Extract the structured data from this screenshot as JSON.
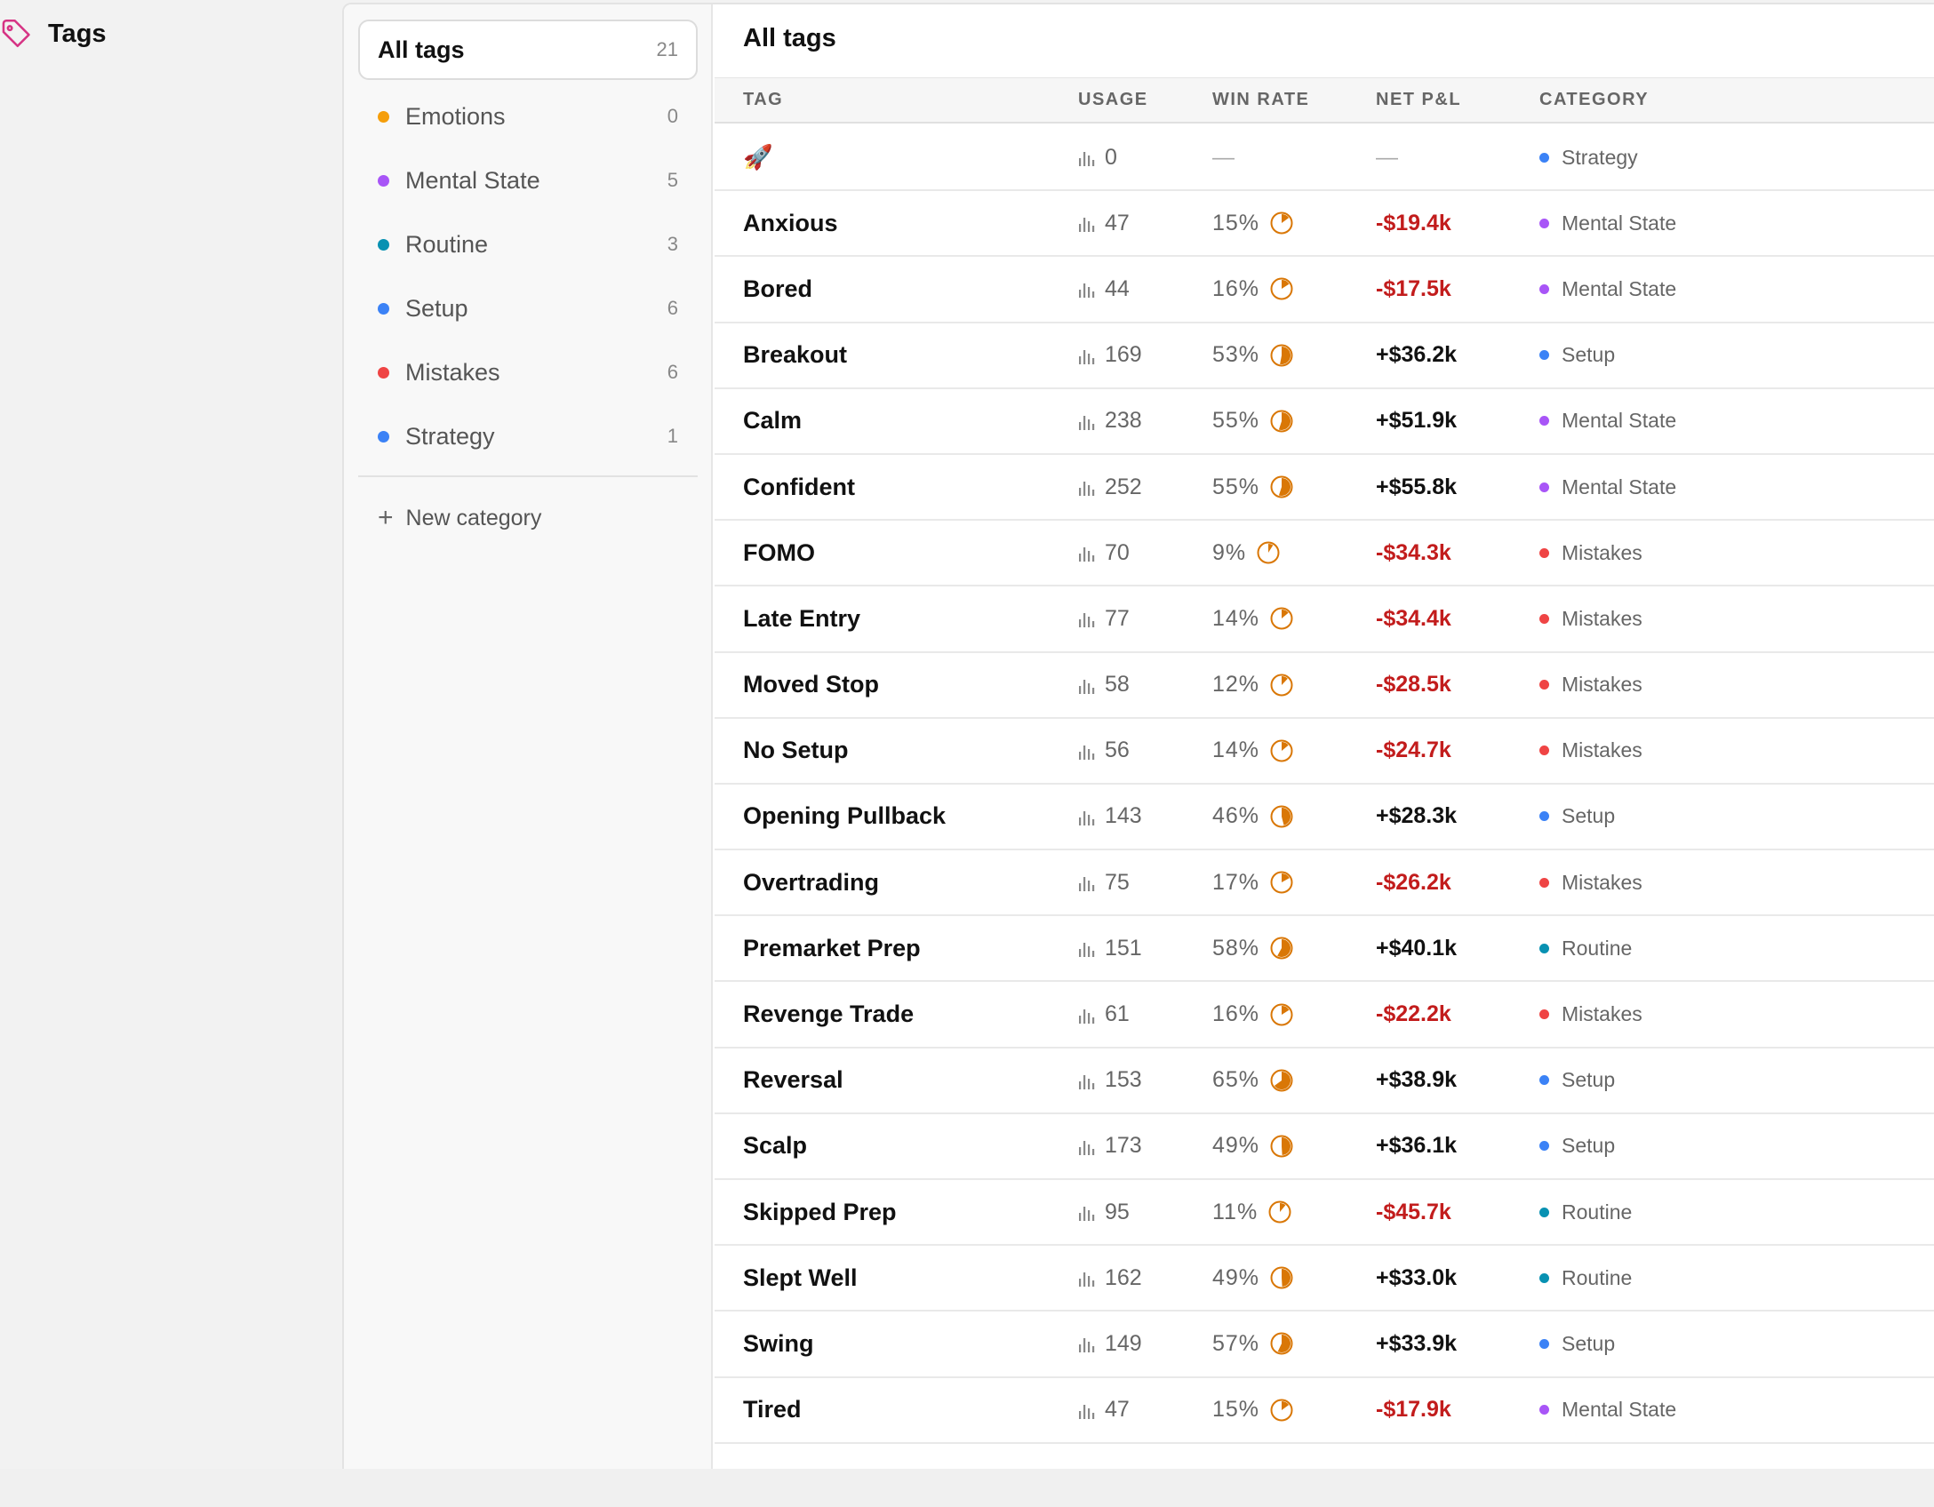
{
  "app": {
    "title": "Tags",
    "icon": "tag-icon"
  },
  "categories_panel": {
    "all": {
      "label": "All tags",
      "count": "21"
    },
    "items": [
      {
        "label": "Emotions",
        "count": "0",
        "color": "#f59e0b"
      },
      {
        "label": "Mental State",
        "count": "5",
        "color": "#a855f7"
      },
      {
        "label": "Routine",
        "count": "3",
        "color": "#0891b2"
      },
      {
        "label": "Setup",
        "count": "6",
        "color": "#3b82f6"
      },
      {
        "label": "Mistakes",
        "count": "6",
        "color": "#ef4444"
      },
      {
        "label": "Strategy",
        "count": "1",
        "color": "#3b82f6"
      }
    ],
    "new_category_label": "New category"
  },
  "table": {
    "title": "All tags",
    "columns": {
      "tag": "TAG",
      "usage": "USAGE",
      "win_rate": "WIN RATE",
      "net_pnl": "NET P&L",
      "category": "CATEGORY"
    },
    "rows": [
      {
        "tag": "🚀",
        "usage": "0",
        "win_rate": "—",
        "win": null,
        "net_pnl": "—",
        "pnl_sign": "nil",
        "category": "Strategy",
        "cat_color": "#3b82f6"
      },
      {
        "tag": "Anxious",
        "usage": "47",
        "win_rate": "15%",
        "win": 0.15,
        "net_pnl": "-$19.4k",
        "pnl_sign": "neg",
        "category": "Mental State",
        "cat_color": "#a855f7"
      },
      {
        "tag": "Bored",
        "usage": "44",
        "win_rate": "16%",
        "win": 0.16,
        "net_pnl": "-$17.5k",
        "pnl_sign": "neg",
        "category": "Mental State",
        "cat_color": "#a855f7"
      },
      {
        "tag": "Breakout",
        "usage": "169",
        "win_rate": "53%",
        "win": 0.53,
        "net_pnl": "+$36.2k",
        "pnl_sign": "pos",
        "category": "Setup",
        "cat_color": "#3b82f6"
      },
      {
        "tag": "Calm",
        "usage": "238",
        "win_rate": "55%",
        "win": 0.55,
        "net_pnl": "+$51.9k",
        "pnl_sign": "pos",
        "category": "Mental State",
        "cat_color": "#a855f7"
      },
      {
        "tag": "Confident",
        "usage": "252",
        "win_rate": "55%",
        "win": 0.55,
        "net_pnl": "+$55.8k",
        "pnl_sign": "pos",
        "category": "Mental State",
        "cat_color": "#a855f7"
      },
      {
        "tag": "FOMO",
        "usage": "70",
        "win_rate": "9%",
        "win": 0.09,
        "net_pnl": "-$34.3k",
        "pnl_sign": "neg",
        "category": "Mistakes",
        "cat_color": "#ef4444"
      },
      {
        "tag": "Late Entry",
        "usage": "77",
        "win_rate": "14%",
        "win": 0.14,
        "net_pnl": "-$34.4k",
        "pnl_sign": "neg",
        "category": "Mistakes",
        "cat_color": "#ef4444"
      },
      {
        "tag": "Moved Stop",
        "usage": "58",
        "win_rate": "12%",
        "win": 0.12,
        "net_pnl": "-$28.5k",
        "pnl_sign": "neg",
        "category": "Mistakes",
        "cat_color": "#ef4444"
      },
      {
        "tag": "No Setup",
        "usage": "56",
        "win_rate": "14%",
        "win": 0.14,
        "net_pnl": "-$24.7k",
        "pnl_sign": "neg",
        "category": "Mistakes",
        "cat_color": "#ef4444"
      },
      {
        "tag": "Opening Pullback",
        "usage": "143",
        "win_rate": "46%",
        "win": 0.46,
        "net_pnl": "+$28.3k",
        "pnl_sign": "pos",
        "category": "Setup",
        "cat_color": "#3b82f6"
      },
      {
        "tag": "Overtrading",
        "usage": "75",
        "win_rate": "17%",
        "win": 0.17,
        "net_pnl": "-$26.2k",
        "pnl_sign": "neg",
        "category": "Mistakes",
        "cat_color": "#ef4444"
      },
      {
        "tag": "Premarket Prep",
        "usage": "151",
        "win_rate": "58%",
        "win": 0.58,
        "net_pnl": "+$40.1k",
        "pnl_sign": "pos",
        "category": "Routine",
        "cat_color": "#0891b2"
      },
      {
        "tag": "Revenge Trade",
        "usage": "61",
        "win_rate": "16%",
        "win": 0.16,
        "net_pnl": "-$22.2k",
        "pnl_sign": "neg",
        "category": "Mistakes",
        "cat_color": "#ef4444"
      },
      {
        "tag": "Reversal",
        "usage": "153",
        "win_rate": "65%",
        "win": 0.65,
        "net_pnl": "+$38.9k",
        "pnl_sign": "pos",
        "category": "Setup",
        "cat_color": "#3b82f6"
      },
      {
        "tag": "Scalp",
        "usage": "173",
        "win_rate": "49%",
        "win": 0.49,
        "net_pnl": "+$36.1k",
        "pnl_sign": "pos",
        "category": "Setup",
        "cat_color": "#3b82f6"
      },
      {
        "tag": "Skipped Prep",
        "usage": "95",
        "win_rate": "11%",
        "win": 0.11,
        "net_pnl": "-$45.7k",
        "pnl_sign": "neg",
        "category": "Routine",
        "cat_color": "#0891b2"
      },
      {
        "tag": "Slept Well",
        "usage": "162",
        "win_rate": "49%",
        "win": 0.49,
        "net_pnl": "+$33.0k",
        "pnl_sign": "pos",
        "category": "Routine",
        "cat_color": "#0891b2"
      },
      {
        "tag": "Swing",
        "usage": "149",
        "win_rate": "57%",
        "win": 0.57,
        "net_pnl": "+$33.9k",
        "pnl_sign": "pos",
        "category": "Setup",
        "cat_color": "#3b82f6"
      },
      {
        "tag": "Tired",
        "usage": "47",
        "win_rate": "15%",
        "win": 0.15,
        "net_pnl": "-$17.9k",
        "pnl_sign": "neg",
        "category": "Mental State",
        "cat_color": "#a855f7"
      }
    ]
  },
  "colors": {
    "accent_orange": "#d97706",
    "negative": "#c21c1c",
    "brand_pink": "#d63384"
  }
}
